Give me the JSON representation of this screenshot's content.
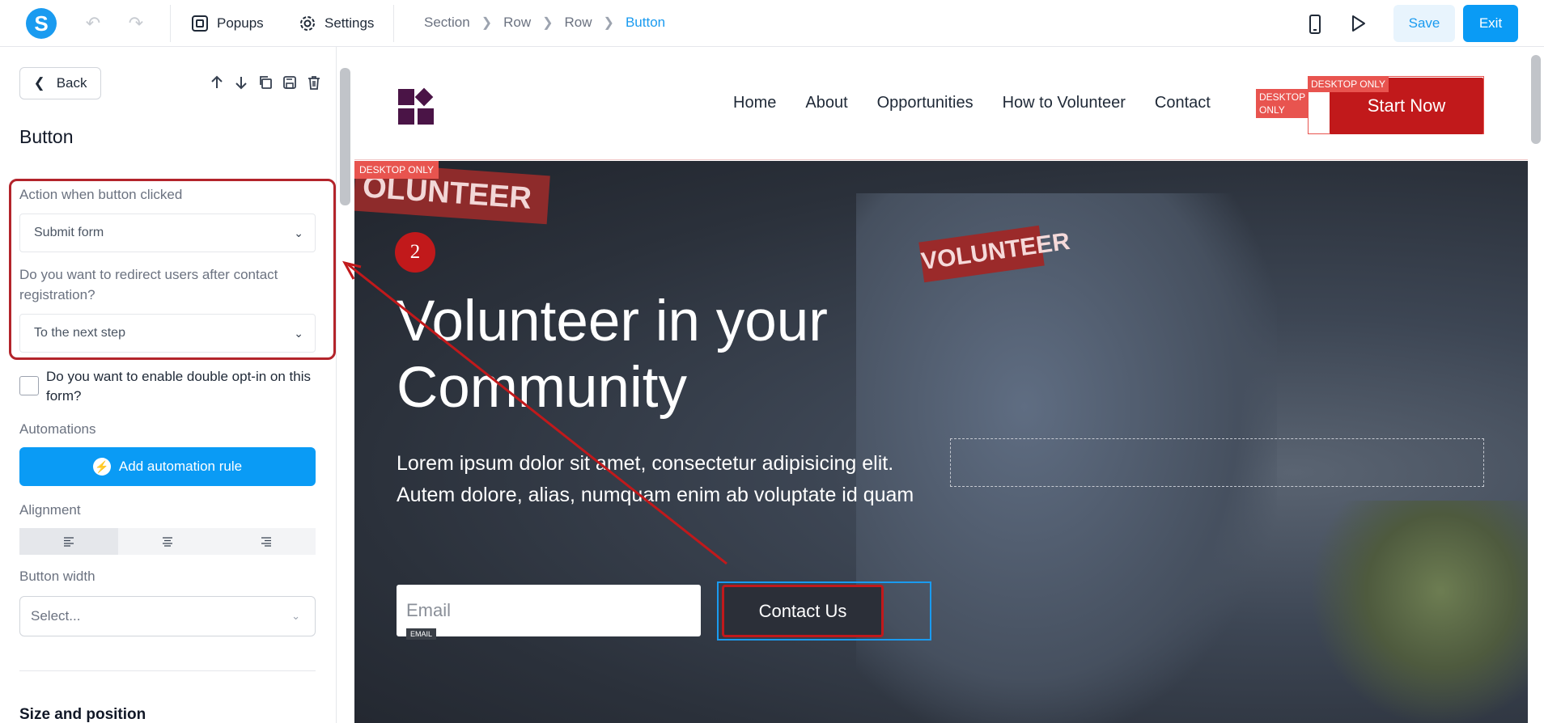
{
  "topbar": {
    "logo_letter": "S",
    "popups_label": "Popups",
    "settings_label": "Settings",
    "breadcrumb": [
      "Section",
      "Row",
      "Row",
      "Button"
    ],
    "save_label": "Save",
    "exit_label": "Exit"
  },
  "sidebar": {
    "back_label": "Back",
    "title": "Button",
    "action_label": "Action when button clicked",
    "action_value": "Submit form",
    "redirect_label": "Do you want to redirect users after contact registration?",
    "redirect_value": "To the next step",
    "double_optin_label": "Do you want to enable double opt-in on this form?",
    "automations_label": "Automations",
    "automation_button": "Add automation rule",
    "alignment_label": "Alignment",
    "button_width_label": "Button width",
    "button_width_placeholder": "Select...",
    "section_heading": "Size and position"
  },
  "site": {
    "nav": [
      "Home",
      "About",
      "Opportunities",
      "How to Volunteer",
      "Contact"
    ],
    "desktop_only": "DESKTOP ONLY",
    "desktop_only_split": [
      "DESKTOP",
      "ONLY"
    ],
    "start_button": "Start Now",
    "hero_title": "Volunteer in your Community",
    "hero_text": "Lorem ipsum dolor sit amet, consectetur adipisicing elit. Autem dolore, alias, numquam enim ab voluptate id quam",
    "email_placeholder": "Email",
    "email_tag": "EMAIL",
    "contact_button": "Contact Us",
    "hero_tag_left": "OLUNTEER",
    "hero_tag_right": "VOLUNTEER",
    "step_number": "2"
  },
  "colors": {
    "accent": "#0a9bf5",
    "annotation_red": "#b3242b",
    "brand_red": "#c1191b"
  }
}
